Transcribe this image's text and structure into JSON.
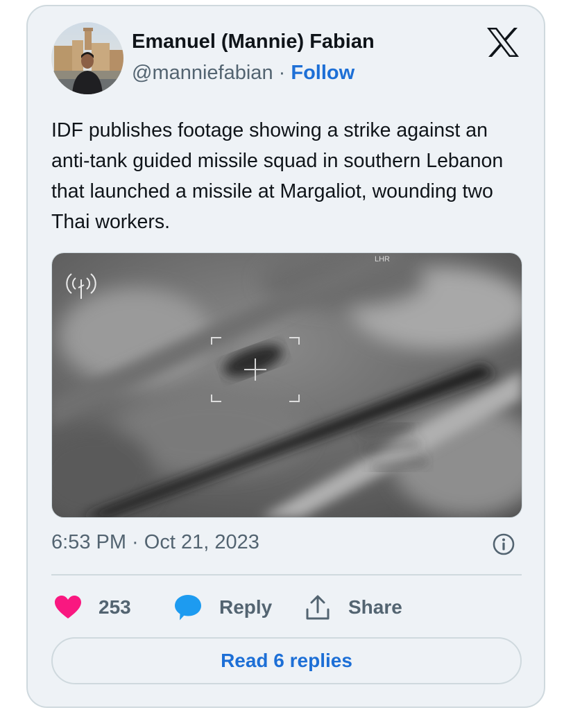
{
  "author": {
    "name": "Emanuel (Mannie) Fabian",
    "handle": "@manniefabian",
    "separator": " · ",
    "follow_label": "Follow"
  },
  "tweet": {
    "text": "IDF publishes footage showing a strike against an anti-tank guided missile squad in southern Lebanon that launched a missile at Margaliot, wounding two Thai workers.",
    "timestamp": "6:53 PM · Oct 21, 2023"
  },
  "media": {
    "type": "video-still",
    "overlay_text": "LHR"
  },
  "actions": {
    "like_count": "253",
    "reply_label": "Reply",
    "share_label": "Share"
  },
  "read_replies_label": "Read 6 replies",
  "icons": {
    "brand": "x-logo-icon",
    "info": "info-icon",
    "like": "heart-icon",
    "reply": "speech-bubble-icon",
    "share": "share-icon"
  },
  "colors": {
    "card_background": "#eef2f6",
    "border": "#cfd9de",
    "link": "#1d6fd6",
    "like": "#f91880",
    "reply": "#1d9bf0",
    "muted_text": "#536471"
  }
}
